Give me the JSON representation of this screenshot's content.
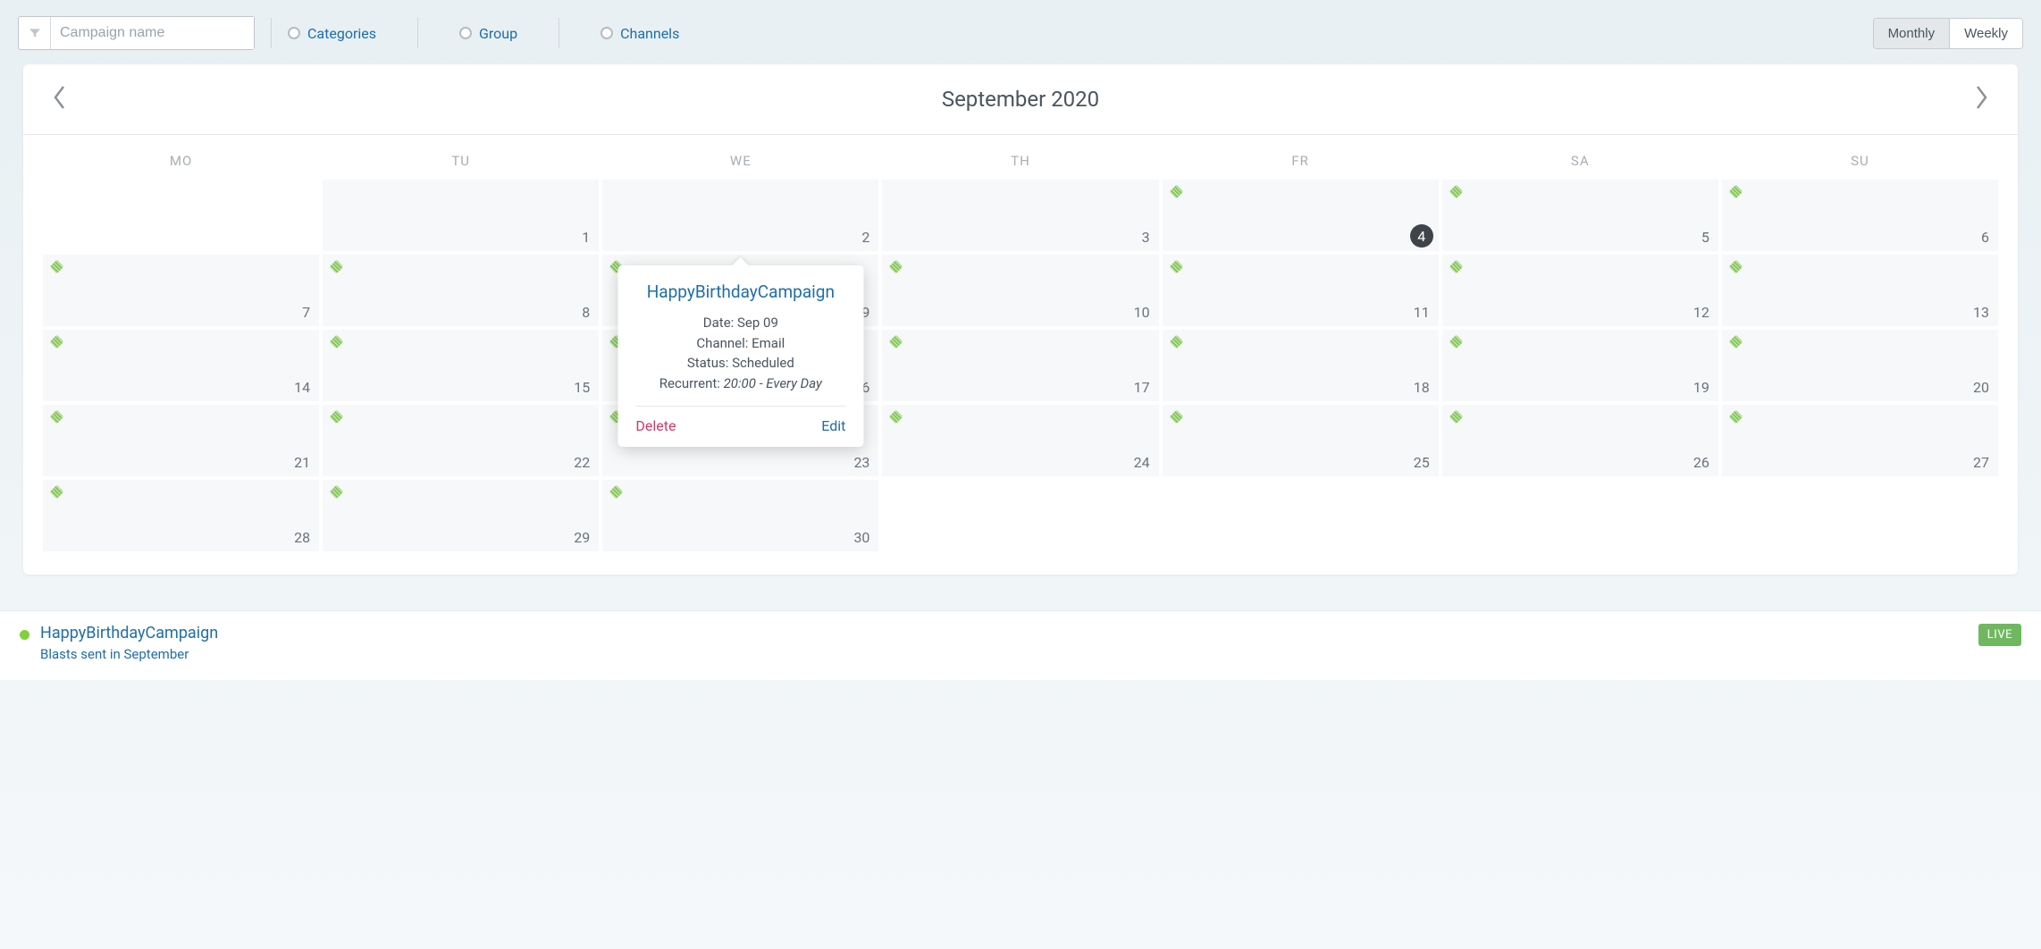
{
  "filters": {
    "search_placeholder": "Campaign name",
    "categories": "Categories",
    "group": "Group",
    "channels": "Channels"
  },
  "view": {
    "monthly": "Monthly",
    "weekly": "Weekly"
  },
  "calendar": {
    "title": "September 2020",
    "weekdays": [
      "MO",
      "TU",
      "WE",
      "TH",
      "FR",
      "SA",
      "SU"
    ],
    "today": 4,
    "rows": [
      [
        null,
        1,
        2,
        3,
        4,
        5,
        6
      ],
      [
        7,
        8,
        9,
        10,
        11,
        12,
        13
      ],
      [
        14,
        15,
        16,
        17,
        18,
        19,
        20
      ],
      [
        21,
        22,
        23,
        24,
        25,
        26,
        27
      ],
      [
        28,
        29,
        30,
        null,
        null,
        null,
        null
      ]
    ],
    "has_event_from": 4
  },
  "popover": {
    "on_day": 9,
    "title": "HappyBirthdayCampaign",
    "date_label": "Date:",
    "date_value": "Sep 09",
    "channel_label": "Channel:",
    "channel_value": "Email",
    "status_label": "Status:",
    "status_value": "Scheduled",
    "recurrent_label": "Recurrent:",
    "recurrent_value": "20:00 - Every Day",
    "delete": "Delete",
    "edit": "Edit"
  },
  "footer": {
    "title": "HappyBirthdayCampaign",
    "subtitle": "Blasts sent in September",
    "live": "LIVE"
  }
}
